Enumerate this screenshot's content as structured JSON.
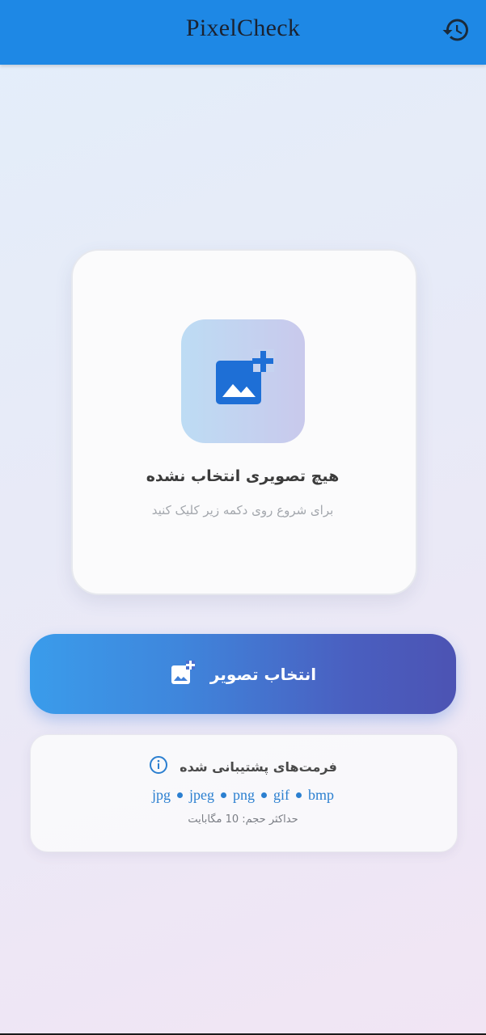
{
  "app_bar": {
    "title": "PixelCheck",
    "history_icon": "history-icon",
    "background": "#1e88e5"
  },
  "preview": {
    "placeholder_icon": "add-photo-icon",
    "empty_title": "هیچ تصویری انتخاب نشده",
    "empty_hint": "برای شروع روی دکمه زیر کلیک کنید"
  },
  "select_button": {
    "label": "انتخاب تصویر",
    "icon": "add-photo-icon"
  },
  "formats": {
    "title": "فرمت‌های پشتیبانی شده",
    "info_icon": "info-icon",
    "list": [
      "jpg",
      "jpeg",
      "png",
      "gif",
      "bmp"
    ],
    "max_size": "حداکثر حجم: 10 مگابایت"
  },
  "colors": {
    "accent": "#1e88e5",
    "format_text": "#2b7fd0",
    "button_gradient_start": "#3a9ceb",
    "button_gradient_end": "#4c53b3"
  }
}
